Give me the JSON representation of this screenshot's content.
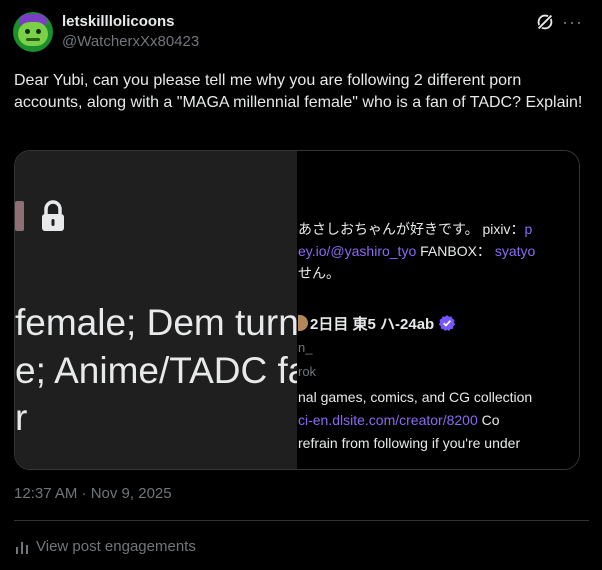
{
  "author": {
    "display_name": "letskilllolicoons",
    "handle": "@WatcherxXx80423"
  },
  "post": {
    "text": "Dear Yubi, can you please tell me why you are following 2 different porn accounts, along with a \"MAGA millennial female\" who is a fan of TADC? Explain!",
    "timestamp": "12:37 AM · Nov 9, 2025"
  },
  "media": {
    "left_lines": [
      "female; Dem turn",
      "e; Anime/TADC fa",
      "r"
    ],
    "right": {
      "line1": "あさしおちゃんが好きです。 pixiv：",
      "line1_link": "p",
      "line2_link": "ey.io/@yashiro_tyo",
      "line2_mid": " FANBOX：",
      "line2_link2": "syatyo",
      "line3": "せん。",
      "badge_text": "2日目 東5 ハ-24ab",
      "gray1": "n_",
      "gray2": "rok",
      "line4": "nal games, comics, and CG collection",
      "line5_link": "ci-en.dlsite.com/creator/8200",
      "line5_tail": " Co",
      "line6": "refrain from following if you're under"
    }
  },
  "footer": {
    "engagements_label": "View post engagements"
  },
  "icons": {
    "grok": "grok-icon",
    "more": "more-icon",
    "lock": "lock-icon",
    "verified": "verified-icon",
    "chart": "bar-chart-icon"
  },
  "colors": {
    "background": "#000000",
    "text": "#e7e9ea",
    "secondary_text": "#71767b",
    "link": "#8b6af2",
    "verified": "#7856ff"
  }
}
